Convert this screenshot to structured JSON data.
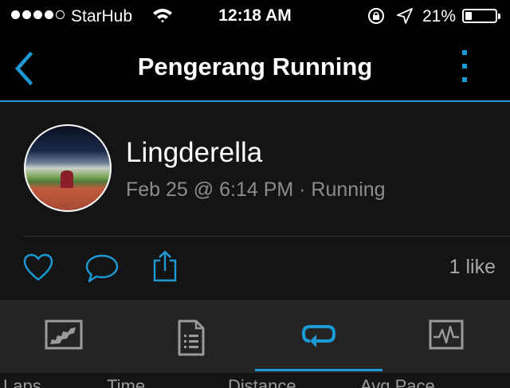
{
  "status_bar": {
    "carrier": "StarHub",
    "time": "12:18 AM",
    "battery_percent": "21%",
    "battery_level": 0.21,
    "signal_bars_filled": 4,
    "signal_bars_total": 5
  },
  "nav": {
    "title": "Pengerang Running",
    "back_icon": "chevron-left-icon",
    "more_icon": "vertical-dots-icon"
  },
  "profile": {
    "name": "Lingderella",
    "meta": "Feb 25 @ 6:14 PM · Running"
  },
  "actions": {
    "like_icon": "heart-icon",
    "comment_icon": "comment-icon",
    "share_icon": "share-icon",
    "likes_count": "1 like"
  },
  "tabs": [
    {
      "icon": "map-icon",
      "active": false
    },
    {
      "icon": "stats-list-icon",
      "active": false
    },
    {
      "icon": "laps-icon",
      "active": true
    },
    {
      "icon": "chart-icon",
      "active": false
    }
  ],
  "columns": [
    "Laps",
    "Time",
    "Distance",
    "Avg Pace"
  ],
  "colors": {
    "accent": "#1c9ad6",
    "background": "#141414",
    "tab_bar": "#242424",
    "secondary_text": "#8c8c8c"
  }
}
